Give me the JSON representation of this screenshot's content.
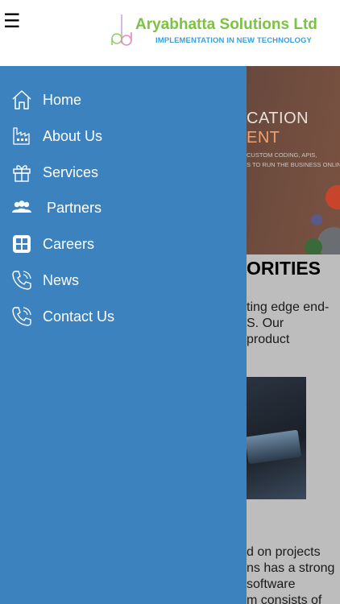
{
  "header": {
    "menu_glyph": "☰",
    "logo": {
      "title": "Aryabhatta Solutions Ltd",
      "tagline": "IMPLEMENTATION IN NEW TECHNOLOGY",
      "title_color": "#7cc242",
      "tagline_color": "#3aa0dc"
    }
  },
  "drawer": {
    "background": "#3b82bf",
    "items": [
      {
        "label": "Home",
        "icon": "home-icon"
      },
      {
        "label": "About Us",
        "icon": "factory-icon"
      },
      {
        "label": "Services",
        "icon": "gift-icon"
      },
      {
        "label": "Partners",
        "icon": "people-icon"
      },
      {
        "label": "Careers",
        "icon": "grid-icon"
      },
      {
        "label": "News",
        "icon": "phone-icon"
      },
      {
        "label": "Contact Us",
        "icon": "phone-icon"
      }
    ]
  },
  "background_page": {
    "hero": {
      "line1": "CATION",
      "line2": "ENT",
      "line3": "CUSTOM CODING, APIS,",
      "line4": "S TO RUN THE BUSINESS ONLINE."
    },
    "priorities_heading": "ORITIES",
    "paragraph1": [
      "ting edge end-",
      "S. Our",
      "product"
    ],
    "paragraph2": [
      "d on projects",
      "ns has a strong",
      "software",
      "m consists of"
    ]
  }
}
